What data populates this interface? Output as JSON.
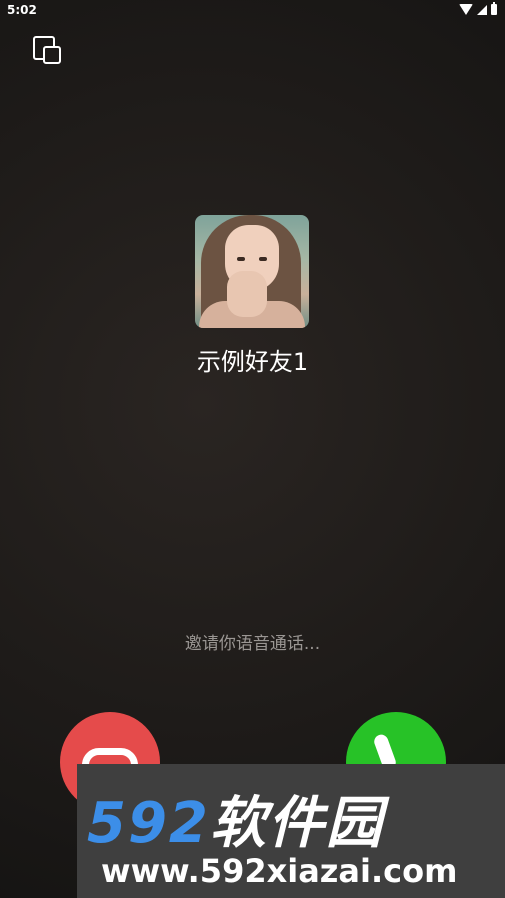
{
  "status_bar": {
    "time": "5:02",
    "icons": [
      "wifi-icon",
      "signal-icon",
      "battery-icon"
    ]
  },
  "top_bar": {
    "float_window_icon": "picture-in-picture-icon"
  },
  "caller": {
    "name": "示例好友1"
  },
  "call_status": {
    "text": "邀请你语音通话..."
  },
  "buttons": {
    "hangup_icon": "hangup-icon",
    "accept_icon": "phone-icon",
    "hangup_color": "#e54b4b",
    "accept_color": "#27c227"
  },
  "watermark": {
    "title_num": "592",
    "title_cn": "软件园",
    "url": "www.592xiazai.com"
  }
}
